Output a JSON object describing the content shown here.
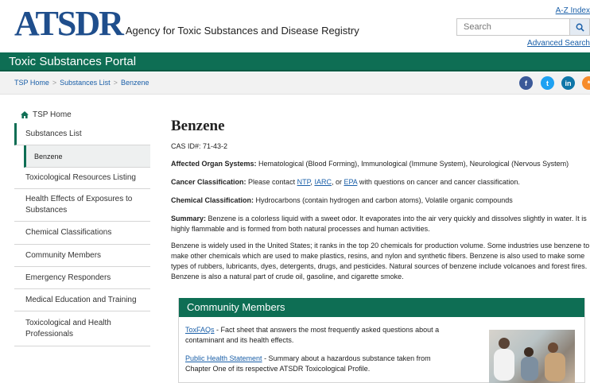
{
  "header": {
    "logo_mark": "ATSDR",
    "logo_text": "Agency for Toxic Substances and Disease Registry",
    "az_index": "A-Z Index",
    "search_placeholder": "Search",
    "advanced_search": "Advanced Search"
  },
  "portal": {
    "title": "Toxic Substances Portal"
  },
  "breadcrumb": [
    "TSP Home",
    "Substances List",
    "Benzene"
  ],
  "social_icons": [
    "facebook-icon",
    "twitter-icon",
    "linkedin-icon",
    "syndicate-icon"
  ],
  "sidebar": {
    "home": "TSP Home",
    "items": [
      {
        "label": "Substances List"
      },
      {
        "label": "Benzene"
      },
      {
        "label": "Toxicological Resources Listing"
      },
      {
        "label": "Health Effects of Exposures to Substances"
      },
      {
        "label": "Chemical Classifications"
      },
      {
        "label": "Community Members"
      },
      {
        "label": "Emergency Responders"
      },
      {
        "label": "Medical Education and Training"
      },
      {
        "label": "Toxicological and Health Professionals"
      }
    ]
  },
  "main": {
    "title": "Benzene",
    "cas": "CAS ID#: 71-43-2",
    "affected_label": "Affected Organ Systems:",
    "affected_text": " Hematological (Blood Forming), Immunological (Immune System), Neurological (Nervous System)",
    "cancer_label": "Cancer Classification:",
    "cancer_pre": "  Please contact ",
    "cancer_ntp": "NTP",
    "cancer_comma1": ", ",
    "cancer_iarc": "IARC",
    "cancer_or": ", or ",
    "cancer_epa": "EPA",
    "cancer_post": " with questions on cancer and cancer classification.",
    "chem_label": "Chemical Classification:",
    "chem_text": " Hydrocarbons (contain hydrogen and carbon atoms), Volatile organic compounds",
    "summary_label": "Summary:",
    "summary_text": " Benzene is a colorless liquid with a sweet odor. It evaporates into the air very quickly and dissolves slightly in water. It is highly flammable and is formed from both natural processes and human activities.",
    "body_text": "Benzene is widely used in the United States; it ranks in the top 20 chemicals for production volume. Some industries use benzene to make other chemicals which are used to make plastics, resins, and nylon and synthetic fibers. Benzene is also used to make some types of rubbers, lubricants, dyes, detergents, drugs, and pesticides. Natural sources of benzene include volcanoes and forest fires. Benzene is also a natural part of crude oil, gasoline, and cigarette smoke."
  },
  "card": {
    "title": "Community Members",
    "toxfaqs_link": "ToxFAQs",
    "toxfaqs_text": " - Fact sheet that answers the most frequently asked questions about a contaminant and its health effects.",
    "phs_link": "Public Health Statement",
    "phs_text": " - Summary about a hazardous substance taken from Chapter One of its respective ATSDR Toxicological Profile."
  },
  "colors": {
    "brand_green": "#0e6e54",
    "logo_blue": "#1f4e8c",
    "link_blue": "#1a5fa8"
  }
}
